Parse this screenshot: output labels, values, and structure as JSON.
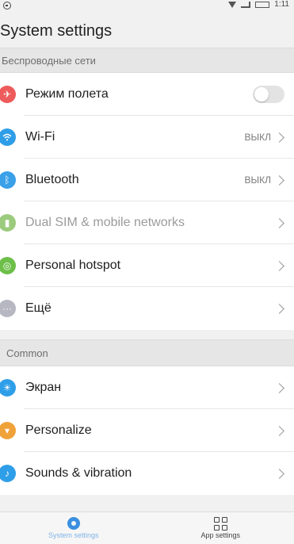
{
  "status_bar": {
    "time": "1:11"
  },
  "page": {
    "title": "System settings"
  },
  "sections": [
    {
      "header": "Беспроводные сети",
      "items": [
        {
          "label": "Режим полета",
          "icon": "airplane-icon",
          "color": "#ee5b5b",
          "type": "toggle",
          "value": "off"
        },
        {
          "label": "Wi-Fi",
          "icon": "wifi-icon",
          "color": "#2f9ee8",
          "value": "ВЫКЛ"
        },
        {
          "label": "Bluetooth",
          "icon": "bluetooth-icon",
          "color": "#3aa0e8",
          "value": "ВЫКЛ"
        },
        {
          "label": "Dual SIM & mobile networks",
          "icon": "sim-icon",
          "color": "#9ccb7e",
          "disabled": true
        },
        {
          "label": "Personal hotspot",
          "icon": "hotspot-icon",
          "color": "#6dbf4a"
        },
        {
          "label": "Ещё",
          "icon": "more-icon",
          "color": "#b7b7c2"
        }
      ]
    },
    {
      "header": "Common",
      "items": [
        {
          "label": "Экран",
          "icon": "brightness-icon",
          "color": "#2f9ee8"
        },
        {
          "label": "Personalize",
          "icon": "shirt-icon",
          "color": "#f0a23a"
        },
        {
          "label": "Sounds & vibration",
          "icon": "sound-icon",
          "color": "#2f9ee8"
        }
      ]
    }
  ],
  "bottom_nav": {
    "tabs": [
      {
        "label": "System settings",
        "icon": "gear-icon",
        "active": true
      },
      {
        "label": "App settings",
        "icon": "apps-grid-icon",
        "active": false
      }
    ]
  }
}
